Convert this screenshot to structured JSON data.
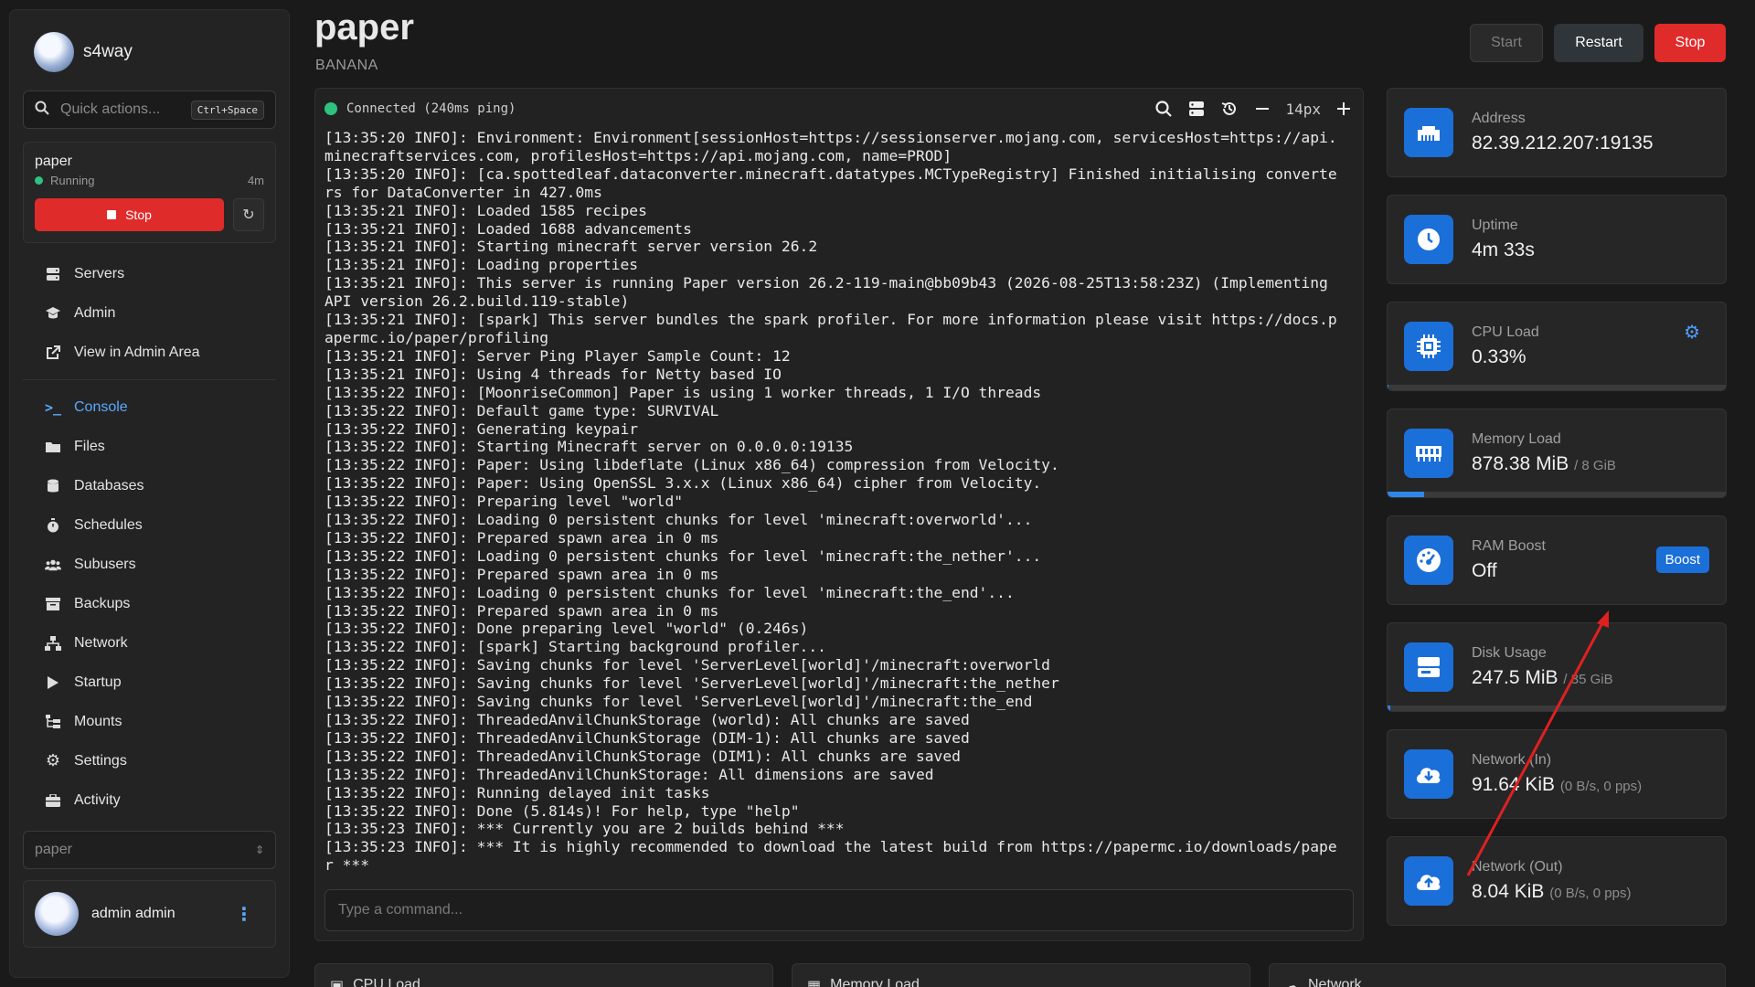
{
  "sidebar": {
    "brand": "s4way",
    "quick_actions": {
      "placeholder": "Quick actions...",
      "shortcut": "Ctrl+Space"
    },
    "server": {
      "name": "paper",
      "status": "Running",
      "uptime_short": "4m",
      "stop_label": "Stop"
    },
    "nav_top": [
      {
        "label": "Servers",
        "icon": "server-icon"
      },
      {
        "label": "Admin",
        "icon": "admin-icon"
      },
      {
        "label": "View in Admin Area",
        "icon": "external-link-icon"
      }
    ],
    "nav_main": [
      {
        "label": "Console",
        "icon": "terminal-icon"
      },
      {
        "label": "Files",
        "icon": "folder-icon"
      },
      {
        "label": "Databases",
        "icon": "database-icon"
      },
      {
        "label": "Schedules",
        "icon": "stopwatch-icon"
      },
      {
        "label": "Subusers",
        "icon": "users-icon"
      },
      {
        "label": "Backups",
        "icon": "archive-icon"
      },
      {
        "label": "Network",
        "icon": "network-icon"
      },
      {
        "label": "Startup",
        "icon": "play-icon"
      },
      {
        "label": "Mounts",
        "icon": "folder-tree-icon"
      },
      {
        "label": "Settings",
        "icon": "gear-icon"
      },
      {
        "label": "Activity",
        "icon": "briefcase-icon"
      }
    ],
    "server_select": "paper",
    "user": {
      "name": "admin admin"
    }
  },
  "header": {
    "title": "paper",
    "subtitle": "BANANA",
    "buttons": {
      "start": "Start",
      "restart": "Restart",
      "stop": "Stop"
    }
  },
  "console": {
    "status": "Connected (240ms ping)",
    "font_size": "14px",
    "lines": [
      "[13:35:20 INFO]: Environment: Environment[sessionHost=https://sessionserver.mojang.com, servicesHost=https://api.minecraftservices.com, profilesHost=https://api.mojang.com, name=PROD]",
      "[13:35:20 INFO]: [ca.spottedleaf.dataconverter.minecraft.datatypes.MCTypeRegistry] Finished initialising converters for DataConverter in 427.0ms",
      "[13:35:21 INFO]: Loaded 1585 recipes",
      "[13:35:21 INFO]: Loaded 1688 advancements",
      "[13:35:21 INFO]: Starting minecraft server version 26.2",
      "[13:35:21 INFO]: Loading properties",
      "[13:35:21 INFO]: This server is running Paper version 26.2-119-main@bb09b43 (2026-08-25T13:58:23Z) (Implementing API version 26.2.build.119-stable)",
      "[13:35:21 INFO]: [spark] This server bundles the spark profiler. For more information please visit https://docs.papermc.io/paper/profiling",
      "[13:35:21 INFO]: Server Ping Player Sample Count: 12",
      "[13:35:21 INFO]: Using 4 threads for Netty based IO",
      "[13:35:22 INFO]: [MoonriseCommon] Paper is using 1 worker threads, 1 I/O threads",
      "[13:35:22 INFO]: Default game type: SURVIVAL",
      "[13:35:22 INFO]: Generating keypair",
      "[13:35:22 INFO]: Starting Minecraft server on 0.0.0.0:19135",
      "[13:35:22 INFO]: Paper: Using libdeflate (Linux x86_64) compression from Velocity.",
      "[13:35:22 INFO]: Paper: Using OpenSSL 3.x.x (Linux x86_64) cipher from Velocity.",
      "[13:35:22 INFO]: Preparing level \"world\"",
      "[13:35:22 INFO]: Loading 0 persistent chunks for level 'minecraft:overworld'...",
      "[13:35:22 INFO]: Prepared spawn area in 0 ms",
      "[13:35:22 INFO]: Loading 0 persistent chunks for level 'minecraft:the_nether'...",
      "[13:35:22 INFO]: Prepared spawn area in 0 ms",
      "[13:35:22 INFO]: Loading 0 persistent chunks for level 'minecraft:the_end'...",
      "[13:35:22 INFO]: Prepared spawn area in 0 ms",
      "[13:35:22 INFO]: Done preparing level \"world\" (0.246s)",
      "[13:35:22 INFO]: [spark] Starting background profiler...",
      "[13:35:22 INFO]: Saving chunks for level 'ServerLevel[world]'/minecraft:overworld",
      "[13:35:22 INFO]: Saving chunks for level 'ServerLevel[world]'/minecraft:the_nether",
      "[13:35:22 INFO]: Saving chunks for level 'ServerLevel[world]'/minecraft:the_end",
      "[13:35:22 INFO]: ThreadedAnvilChunkStorage (world): All chunks are saved",
      "[13:35:22 INFO]: ThreadedAnvilChunkStorage (DIM-1): All chunks are saved",
      "[13:35:22 INFO]: ThreadedAnvilChunkStorage (DIM1): All chunks are saved",
      "[13:35:22 INFO]: ThreadedAnvilChunkStorage: All dimensions are saved",
      "[13:35:22 INFO]: Running delayed init tasks",
      "[13:35:22 INFO]: Done (5.814s)! For help, type \"help\"",
      "[13:35:23 INFO]: *** Currently you are 2 builds behind ***",
      "[13:35:23 INFO]: *** It is highly recommended to download the latest build from https://papermc.io/downloads/paper ***"
    ],
    "command_placeholder": "Type a command..."
  },
  "stats": {
    "address": {
      "label": "Address",
      "value": "82.39.212.207:19135",
      "icon": "ethernet-icon"
    },
    "uptime": {
      "label": "Uptime",
      "value": "4m 33s",
      "icon": "clock-icon"
    },
    "cpu": {
      "label": "CPU Load",
      "value": "0.33%",
      "icon": "cpu-icon",
      "bar_fraction": 0.0033
    },
    "memory": {
      "label": "Memory Load",
      "value": "878.38 MiB",
      "limit": "/ 8 GiB",
      "icon": "memory-icon",
      "bar_fraction": 0.107
    },
    "ram_boost": {
      "label": "RAM Boost",
      "value": "Off",
      "button": "Boost",
      "icon": "gauge-icon"
    },
    "disk": {
      "label": "Disk Usage",
      "value": "247.5 MiB",
      "limit": "/ 35 GiB",
      "icon": "disk-icon",
      "bar_fraction": 0.007
    },
    "net_in": {
      "label": "Network (In)",
      "value": "91.64 KiB",
      "rate": "(0 B/s, 0 pps)",
      "icon": "cloud-download-icon"
    },
    "net_out": {
      "label": "Network (Out)",
      "value": "8.04 KiB",
      "rate": "(0 B/s, 0 pps)",
      "icon": "cloud-upload-icon"
    }
  },
  "bottom_cards": [
    {
      "label": "CPU Load"
    },
    {
      "label": "Memory Load"
    },
    {
      "label": "Network"
    }
  ],
  "colors": {
    "accent": "#1b6fd8",
    "danger": "#e02b2b",
    "success": "#2ec27e",
    "annotation": "#e02020"
  }
}
